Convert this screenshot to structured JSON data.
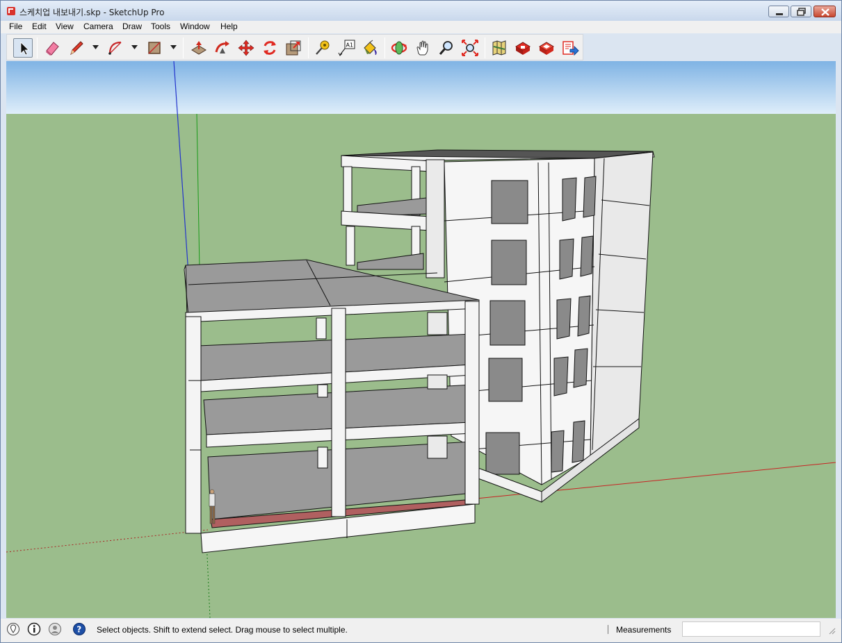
{
  "window": {
    "title": "스케치업 내보내기.skp - SketchUp Pro"
  },
  "menu": [
    "File",
    "Edit",
    "View",
    "Camera",
    "Draw",
    "Tools",
    "Window",
    "Help"
  ],
  "toolbar": {
    "tools": [
      "select-tool",
      "eraser-tool",
      "pencil-tool",
      "arc-tool",
      "rectangle-tool",
      "push-pull-tool",
      "follow-me-tool",
      "move-tool",
      "rotate-tool",
      "scale-tool",
      "tape-measure-tool",
      "text-tool",
      "paint-bucket-tool",
      "orbit-tool",
      "pan-tool",
      "zoom-tool",
      "zoom-extents-tool",
      "3d-warehouse-tool",
      "extension-warehouse-tool",
      "layout-tool",
      "send-to-layout-tool"
    ],
    "active_tool": "select-tool",
    "text_tool_glyph": "A1"
  },
  "status": {
    "hint": "Select objects. Shift to extend select. Drag mouse to select multiple.",
    "measurements_label": "Measurements",
    "measurements_value": ""
  },
  "colors": {
    "sky_top": "#7fb3e4",
    "sky_bottom": "#dfeefa",
    "ground": "#9bbd8c",
    "red_axis": "#d22",
    "green_axis": "#1a9a1a",
    "blue_axis": "#2233cc",
    "slab_top": "#9a9a9a",
    "wall": "#f4f4f4"
  }
}
